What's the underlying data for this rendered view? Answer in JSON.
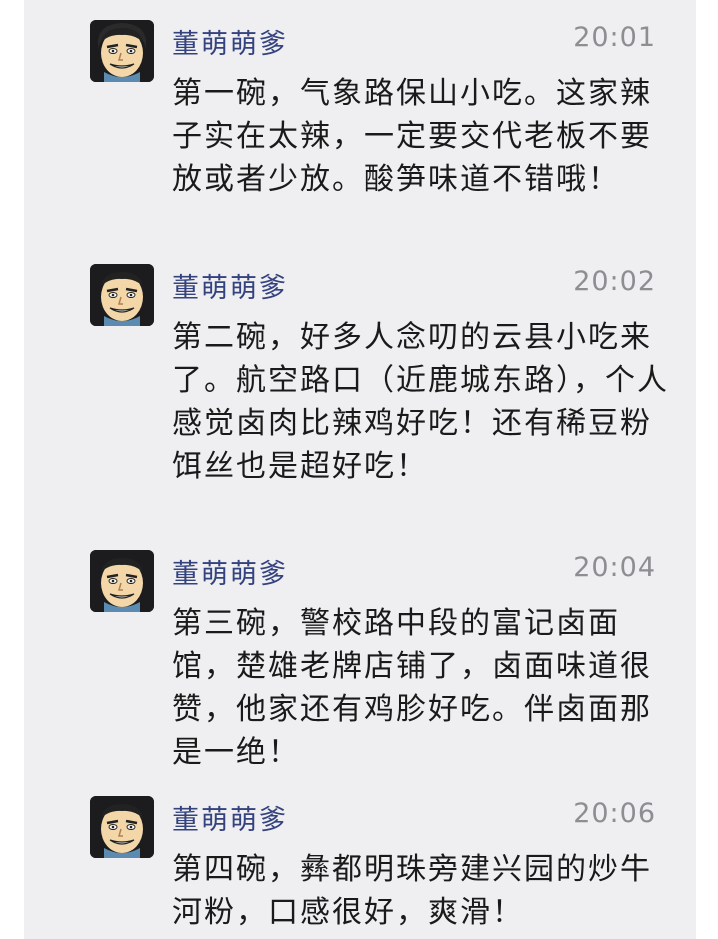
{
  "messages": [
    {
      "sender": "董萌萌爹",
      "time": "20:01",
      "text": "第一碗，气象路保山小吃。这家辣子实在太辣，一定要交代老板不要放或者少放。酸笋味道不错哦！",
      "avatar_icon": "cartoon-face-avatar-icon"
    },
    {
      "sender": "董萌萌爹",
      "time": "20:02",
      "text": "第二碗，好多人念叨的云县小吃来了。航空路口（近鹿城东路），个人感觉卤肉比辣鸡好吃！还有稀豆粉饵丝也是超好吃！",
      "avatar_icon": "cartoon-face-avatar-icon"
    },
    {
      "sender": "董萌萌爹",
      "time": "20:04",
      "text": "第三碗，警校路中段的富记卤面馆，楚雄老牌店铺了，卤面味道很赞，他家还有鸡胗好吃。伴卤面那是一绝！",
      "avatar_icon": "cartoon-face-avatar-icon"
    },
    {
      "sender": "董萌萌爹",
      "time": "20:06",
      "text": "第四碗，彝都明珠旁建兴园的炒牛河粉，口感很好，爽滑！",
      "avatar_icon": "cartoon-face-avatar-icon"
    }
  ],
  "colors": {
    "background": "#efeff1",
    "sender_name": "#34427e",
    "timestamp": "#8d8d92",
    "message_text": "#1a1a1a"
  }
}
